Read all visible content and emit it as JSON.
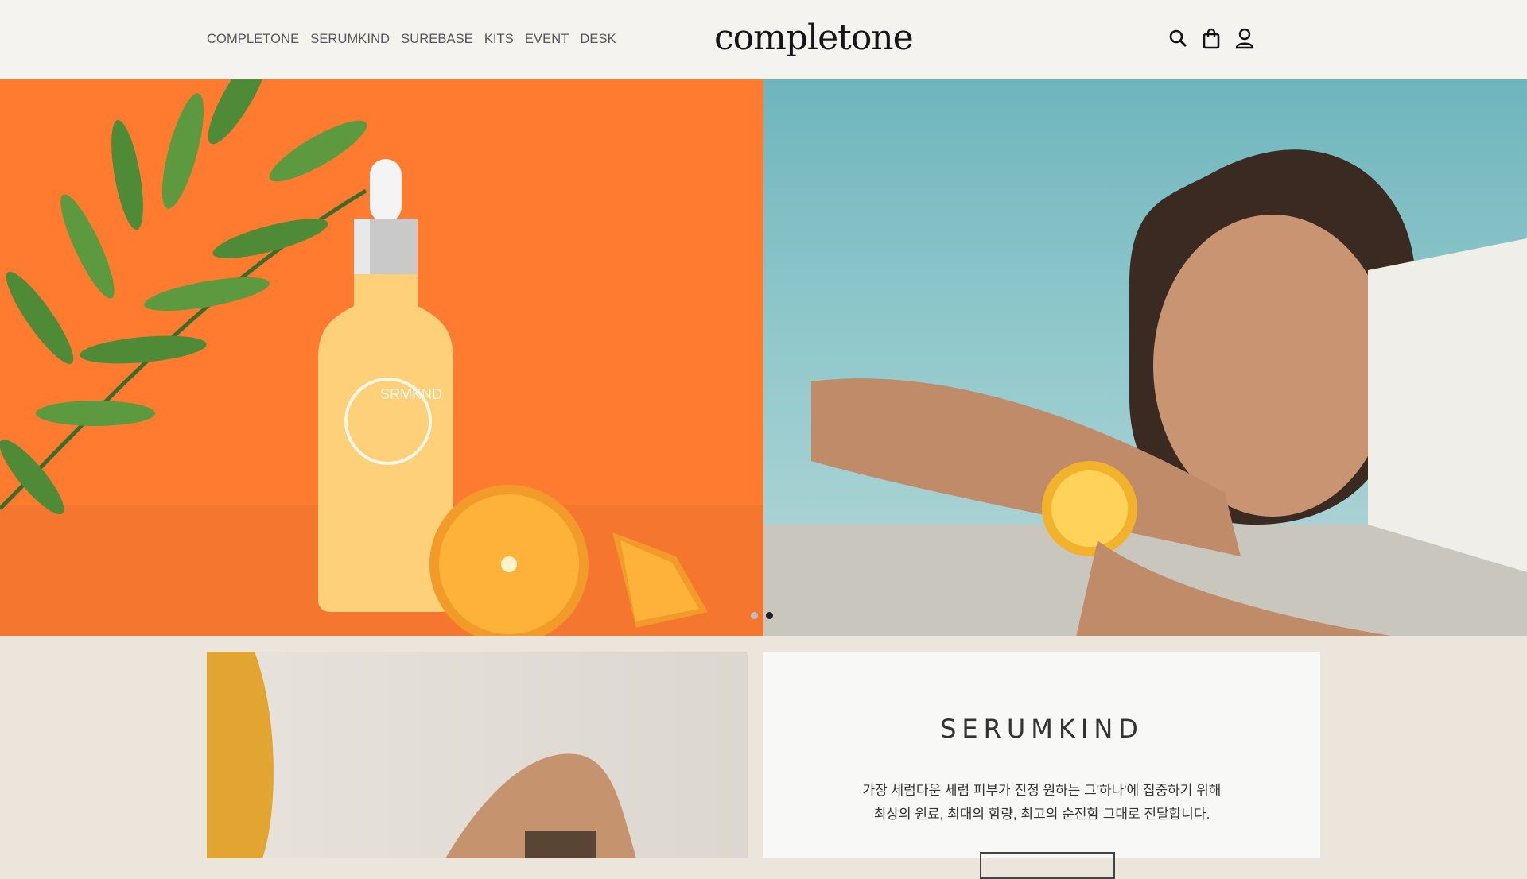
{
  "nav": {
    "items": [
      "COMPLETONE",
      "SERUMKIND",
      "SUREBASE",
      "KITS",
      "EVENT",
      "DESK"
    ]
  },
  "logo": "completone",
  "icons": [
    "search-icon",
    "shopping-bag-icon",
    "user-icon"
  ],
  "hero": {
    "bottle_label": "SRMKND",
    "slides": 2,
    "active_slide": 2
  },
  "section": {
    "title": "SERUMKIND",
    "desc_line1": "가장 세럼다운 세럼 피부가 진정 원하는 그'하나'에 집중하기 위해",
    "desc_line2": "최상의 원료, 최대의 함량, 최고의 순전함 그대로 전달합니다."
  },
  "colors": {
    "header_bg": "#f5f3ef",
    "hero_orange": "#ff7b30",
    "page_bg": "#ebe5db"
  }
}
